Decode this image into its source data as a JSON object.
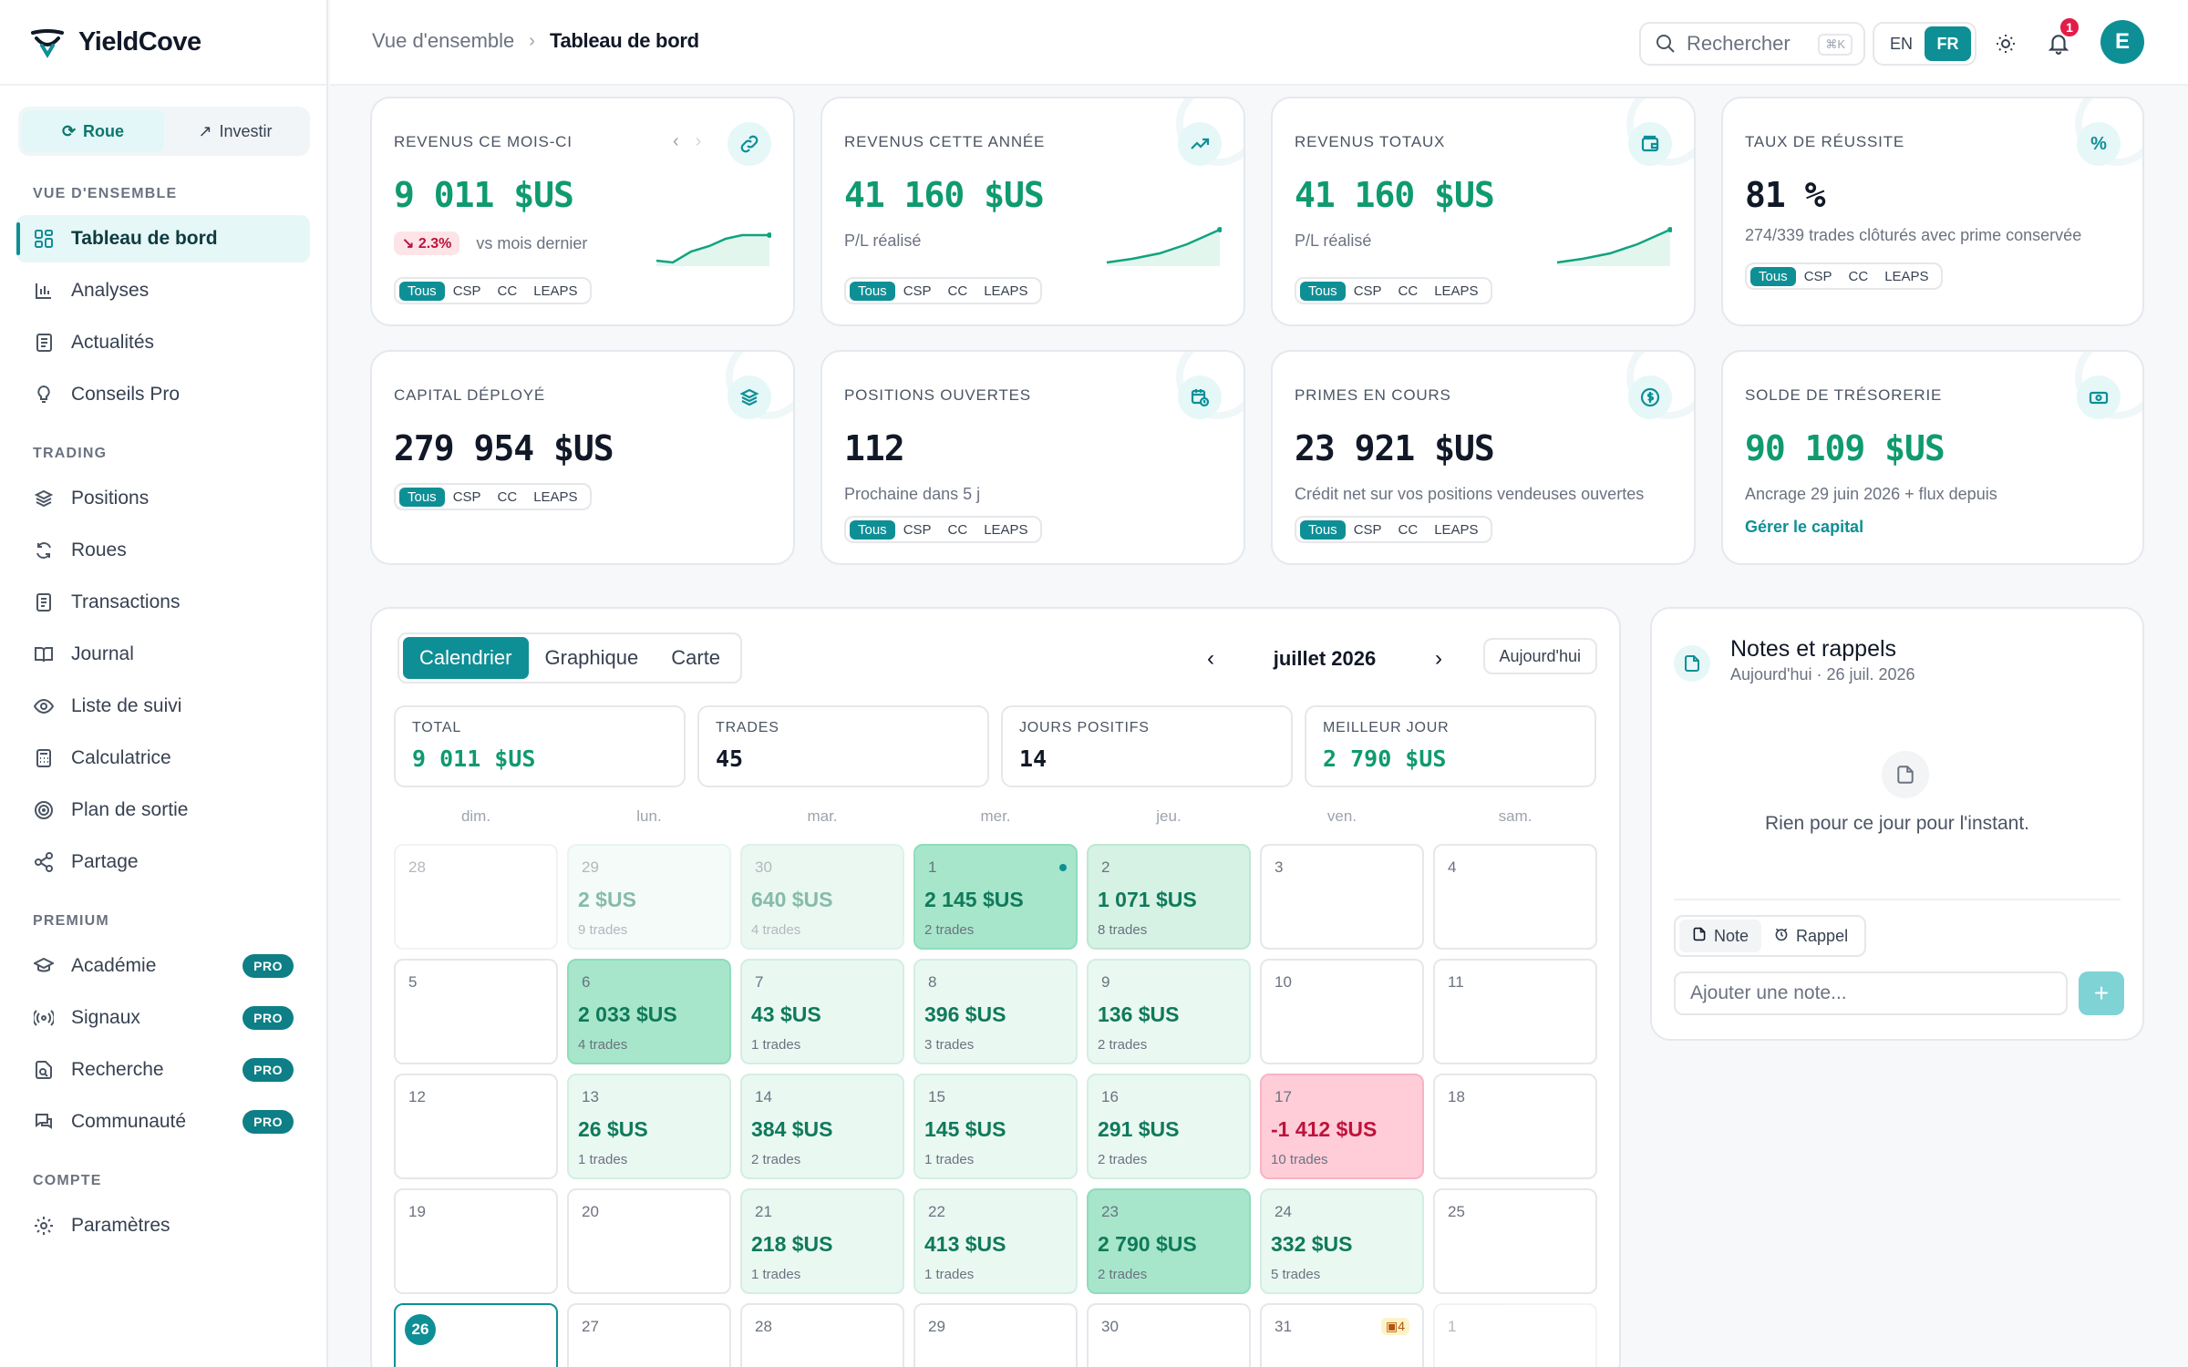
{
  "brand": {
    "name": "YieldCove"
  },
  "mode": {
    "options": [
      {
        "label": "Roue",
        "icon": "refresh-icon"
      },
      {
        "label": "Investir",
        "icon": "trend-up-icon"
      }
    ],
    "active": "Roue"
  },
  "nav": {
    "overview_title": "VUE D'ENSEMBLE",
    "overview": [
      {
        "label": "Tableau de bord",
        "icon": "dashboard-icon"
      },
      {
        "label": "Analyses",
        "icon": "bar-chart-icon"
      },
      {
        "label": "Actualités",
        "icon": "newspaper-icon"
      },
      {
        "label": "Conseils Pro",
        "icon": "lightbulb-icon"
      }
    ],
    "trading_title": "TRADING",
    "trading": [
      {
        "label": "Positions",
        "icon": "layers-icon"
      },
      {
        "label": "Roues",
        "icon": "refresh-icon"
      },
      {
        "label": "Transactions",
        "icon": "receipt-icon"
      },
      {
        "label": "Journal",
        "icon": "book-icon"
      },
      {
        "label": "Liste de suivi",
        "icon": "eye-icon"
      },
      {
        "label": "Calculatrice",
        "icon": "calculator-icon"
      },
      {
        "label": "Plan de sortie",
        "icon": "target-icon"
      },
      {
        "label": "Partage",
        "icon": "share-icon"
      }
    ],
    "premium_title": "PREMIUM",
    "premium": [
      {
        "label": "Académie",
        "icon": "graduation-icon",
        "badge": "PRO"
      },
      {
        "label": "Signaux",
        "icon": "radio-icon",
        "badge": "PRO"
      },
      {
        "label": "Recherche",
        "icon": "document-search-icon",
        "badge": "PRO"
      },
      {
        "label": "Communauté",
        "icon": "chat-icon",
        "badge": "PRO"
      }
    ],
    "account_title": "COMPTE",
    "account": [
      {
        "label": "Paramètres",
        "icon": "gear-icon"
      }
    ]
  },
  "header": {
    "breadcrumb": [
      "Vue d'ensemble",
      "Tableau de bord"
    ],
    "search_placeholder": "Rechercher",
    "search_shortcut": "⌘K",
    "languages": [
      "EN",
      "FR"
    ],
    "active_language": "FR",
    "notifications": "1",
    "avatar_initial": "E"
  },
  "filters": [
    "Tous",
    "CSP",
    "CC",
    "LEAPS"
  ],
  "stats": {
    "month": {
      "label": "REVENUS CE MOIS-CI",
      "value": "9 011  $US",
      "change": "↘ 2.3%",
      "change_text": "vs mois dernier"
    },
    "year": {
      "label": "REVENUS CETTE ANNÉE",
      "value": "41 160  $US",
      "sub": "P/L réalisé"
    },
    "total": {
      "label": "REVENUS TOTAUX",
      "value": "41 160  $US",
      "sub": "P/L réalisé"
    },
    "success": {
      "label": "TAUX DE RÉUSSITE",
      "value": "81  %",
      "sub": "274/339 trades clôturés avec prime conservée"
    },
    "capital": {
      "label": "CAPITAL DÉPLOYÉ",
      "value": "279 954  $US"
    },
    "positions": {
      "label": "POSITIONS OUVERTES",
      "value": "112",
      "sub": "Prochaine dans 5 j"
    },
    "premiums": {
      "label": "PRIMES EN COURS",
      "value": "23 921  $US",
      "sub": "Crédit net sur vos positions vendeuses ouvertes"
    },
    "cash": {
      "label": "SOLDE DE TRÉSORERIE",
      "value": "90 109  $US",
      "sub": "Ancrage 29 juin 2026 + flux depuis",
      "link": "Gérer le capital"
    }
  },
  "calendar": {
    "tabs": [
      "Calendrier",
      "Graphique",
      "Carte"
    ],
    "active_tab": "Calendrier",
    "month": "juillet 2026",
    "today_button": "Aujourd'hui",
    "summary": [
      {
        "key": "TOTAL",
        "value": "9 011  $US",
        "green": true
      },
      {
        "key": "TRADES",
        "value": "45",
        "green": false
      },
      {
        "key": "JOURS POSITIFS",
        "value": "14",
        "green": false
      },
      {
        "key": "MEILLEUR JOUR",
        "value": "2 790  $US",
        "green": true
      }
    ],
    "weekdays": [
      "dim.",
      "lun.",
      "mar.",
      "mer.",
      "jeu.",
      "ven.",
      "sam."
    ],
    "weeks": [
      [
        {
          "n": "28",
          "faded": true
        },
        {
          "n": "29",
          "amt": "2 $US",
          "trades": "9 trades",
          "level": "l1",
          "faded": true
        },
        {
          "n": "30",
          "amt": "640 $US",
          "trades": "4 trades",
          "level": "l2",
          "faded": true
        },
        {
          "n": "1",
          "amt": "2 145 $US",
          "trades": "2 trades",
          "level": "l3",
          "dot": true
        },
        {
          "n": "2",
          "amt": "1 071 $US",
          "trades": "8 trades",
          "level": "l2"
        },
        {
          "n": "3"
        },
        {
          "n": "4"
        }
      ],
      [
        {
          "n": "5"
        },
        {
          "n": "6",
          "amt": "2 033 $US",
          "trades": "4 trades",
          "level": "l3"
        },
        {
          "n": "7",
          "amt": "43 $US",
          "trades": "1 trades",
          "level": "l1"
        },
        {
          "n": "8",
          "amt": "396 $US",
          "trades": "3 trades",
          "level": "l1"
        },
        {
          "n": "9",
          "amt": "136 $US",
          "trades": "2 trades",
          "level": "l1"
        },
        {
          "n": "10"
        },
        {
          "n": "11"
        }
      ],
      [
        {
          "n": "12"
        },
        {
          "n": "13",
          "amt": "26 $US",
          "trades": "1 trades",
          "level": "l1"
        },
        {
          "n": "14",
          "amt": "384 $US",
          "trades": "2 trades",
          "level": "l1"
        },
        {
          "n": "15",
          "amt": "145 $US",
          "trades": "1 trades",
          "level": "l1"
        },
        {
          "n": "16",
          "amt": "291 $US",
          "trades": "2 trades",
          "level": "l1"
        },
        {
          "n": "17",
          "amt": "-1 412 $US",
          "trades": "10 trades",
          "level": "neg"
        },
        {
          "n": "18"
        }
      ],
      [
        {
          "n": "19"
        },
        {
          "n": "20"
        },
        {
          "n": "21",
          "amt": "218 $US",
          "trades": "1 trades",
          "level": "l1"
        },
        {
          "n": "22",
          "amt": "413 $US",
          "trades": "1 trades",
          "level": "l1"
        },
        {
          "n": "23",
          "amt": "2 790 $US",
          "trades": "2 trades",
          "level": "l3"
        },
        {
          "n": "24",
          "amt": "332 $US",
          "trades": "5 trades",
          "level": "l1"
        },
        {
          "n": "25"
        }
      ],
      [
        {
          "n": "26",
          "today": true
        },
        {
          "n": "27"
        },
        {
          "n": "28"
        },
        {
          "n": "29"
        },
        {
          "n": "30"
        },
        {
          "n": "31",
          "event": "4"
        },
        {
          "n": "1",
          "faded": true
        }
      ]
    ]
  },
  "notes": {
    "title": "Notes et rappels",
    "date": "Aujourd'hui · 26 juil. 2026",
    "empty": "Rien pour ce jour pour l'instant.",
    "tabs": [
      "Note",
      "Rappel"
    ],
    "active_tab": "Note",
    "input_placeholder": "Ajouter une note...",
    "add_label": "+"
  }
}
